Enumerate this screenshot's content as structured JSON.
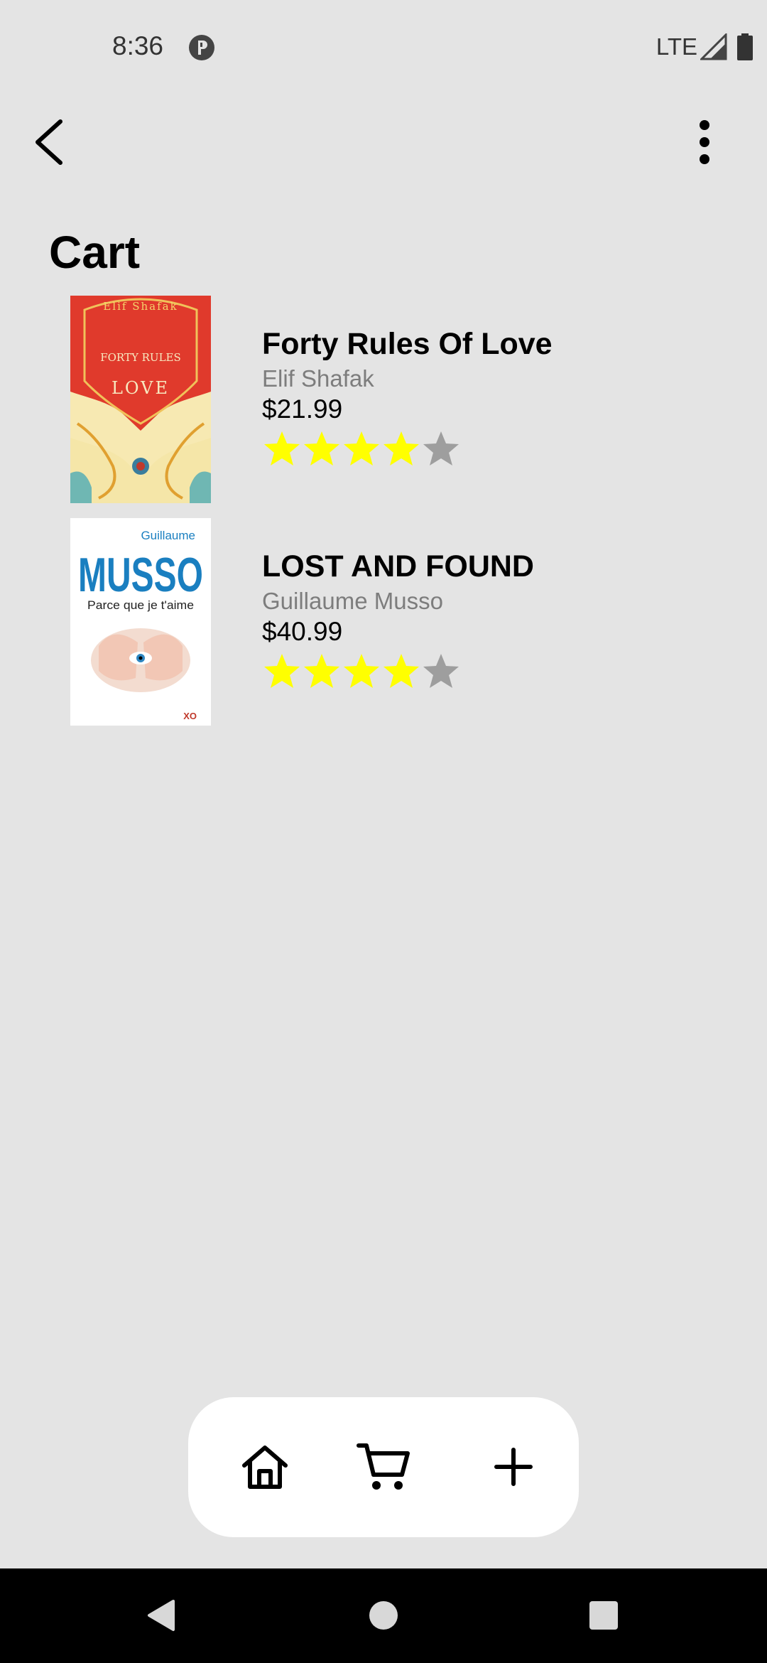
{
  "status_bar": {
    "time": "8:36",
    "network": "LTE",
    "icons": [
      "app-notification-icon",
      "signal-icon",
      "battery-icon"
    ]
  },
  "app_bar": {
    "back_icon": "chevron-left-icon",
    "menu_icon": "more-vertical-icon"
  },
  "page": {
    "title": "Cart"
  },
  "cart": {
    "items": [
      {
        "title": "Forty Rules Of Love",
        "author": "Elif Shafak",
        "price": "$21.99",
        "rating": 4,
        "rating_max": 5,
        "cover": {
          "author_text": "Elif Shafak",
          "title_line1": "FORTY RULES",
          "title_line2": "LOVE"
        }
      },
      {
        "title": "LOST AND FOUND",
        "author": "Guillaume Musso",
        "price": "$40.99",
        "rating": 4,
        "rating_max": 5,
        "cover": {
          "first_name": "Guillaume",
          "last_name": "MUSSO",
          "subtitle": "Parce que je t'aime",
          "publisher": "XO"
        }
      }
    ]
  },
  "bottom_nav": {
    "items": [
      "home-icon",
      "cart-icon",
      "add-icon"
    ]
  },
  "colors": {
    "background": "#e4e4e4",
    "star_filled": "#ffff00",
    "star_empty": "#9e9e9e",
    "author_gray": "#7d7d7d",
    "nav_bg": "#ffffff",
    "musso_blue": "#1a7fc0",
    "shafak_red": "#e03a2c"
  }
}
